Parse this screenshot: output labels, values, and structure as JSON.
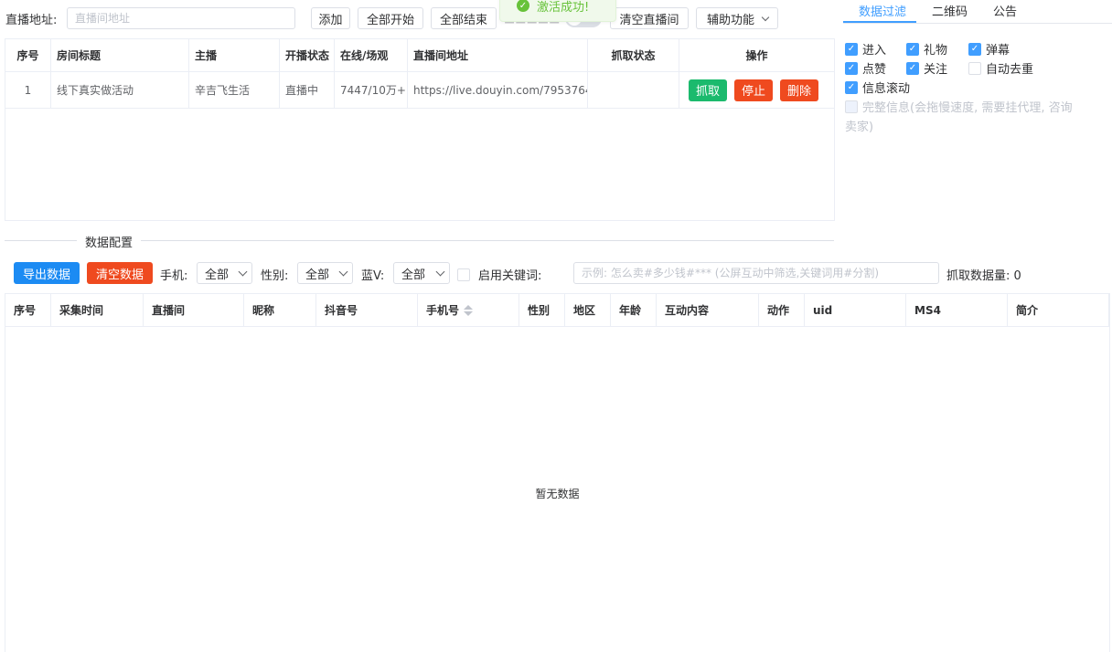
{
  "toolbar": {
    "url_label": "直播地址:",
    "url_placeholder": "直播间地址",
    "add": "添加",
    "start_all": "全部开始",
    "end_all": "全部结束",
    "clear_rooms": "清空直播间",
    "assist": "辅助功能"
  },
  "toast": {
    "message": "激活成功!"
  },
  "room_table": {
    "headers": [
      "序号",
      "房间标题",
      "主播",
      "开播状态",
      "在线/场观",
      "直播间地址",
      "抓取状态",
      "操作"
    ],
    "rows": [
      {
        "index": "1",
        "title": "线下真实做活动",
        "anchor": "辛吉飞生活",
        "status": "直播中",
        "online": "7447/10万+",
        "url": "https://live.douyin.com/7953764...",
        "crawl_status": ""
      }
    ],
    "actions": {
      "crawl": "抓取",
      "stop": "停止",
      "delete": "删除"
    }
  },
  "tabs": [
    "数据过滤",
    "二维码",
    "公告"
  ],
  "filters": {
    "items": [
      {
        "label": "进入",
        "checked": true
      },
      {
        "label": "礼物",
        "checked": true
      },
      {
        "label": "弹幕",
        "checked": true
      },
      {
        "label": "点赞",
        "checked": true
      },
      {
        "label": "关注",
        "checked": true
      },
      {
        "label": "自动去重",
        "checked": false
      },
      {
        "label": "信息滚动",
        "checked": true
      }
    ],
    "full_info_line1": "完整信息(会拖慢速度, 需要挂代理, 咨询",
    "full_info_line2": "卖家)"
  },
  "data_config": {
    "title": "数据配置",
    "export": "导出数据",
    "clear": "清空数据",
    "phone_label": "手机:",
    "phone_value": "全部",
    "gender_label": "性别:",
    "gender_value": "全部",
    "bluev_label": "蓝V:",
    "bluev_value": "全部",
    "keyword_label": "启用关键词:",
    "keyword_placeholder": "示例: 怎么卖#多少钱#*** (公屏互动中筛选,关键词用#分割)",
    "count_label": "抓取数据量: 0"
  },
  "data_table": {
    "headers": [
      "序号",
      "采集时间",
      "直播间",
      "昵称",
      "抖音号",
      "手机号",
      "性别",
      "地区",
      "年龄",
      "互动内容",
      "动作",
      "uid",
      "MS4",
      "简介"
    ],
    "empty_text": "暂无数据"
  },
  "colors": {
    "primary": "#409eff",
    "success": "#1bba6d",
    "danger": "#ef4a1f",
    "border": "#ebeef5"
  }
}
